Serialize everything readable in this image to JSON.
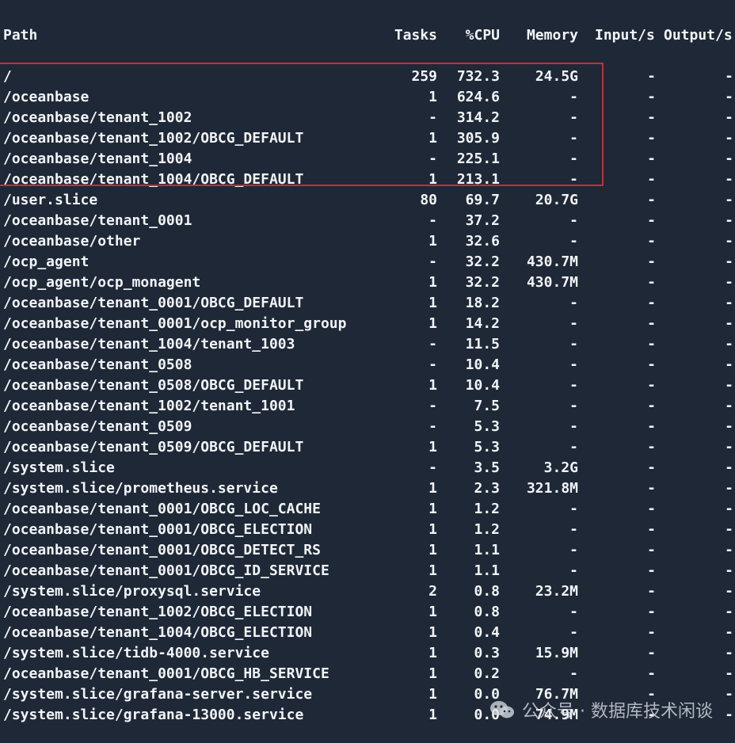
{
  "columns": {
    "path": "Path",
    "tasks": "Tasks",
    "cpu": "%CPU",
    "memory": "Memory",
    "input": "Input/s",
    "output": "Output/s"
  },
  "rows": [
    {
      "path": "/",
      "tasks": "259",
      "cpu": "732.3",
      "memory": "24.5G",
      "input": "-",
      "output": "-"
    },
    {
      "path": "/oceanbase",
      "tasks": "1",
      "cpu": "624.6",
      "memory": "-",
      "input": "-",
      "output": "-"
    },
    {
      "path": "/oceanbase/tenant_1002",
      "tasks": "-",
      "cpu": "314.2",
      "memory": "-",
      "input": "-",
      "output": "-"
    },
    {
      "path": "/oceanbase/tenant_1002/OBCG_DEFAULT",
      "tasks": "1",
      "cpu": "305.9",
      "memory": "-",
      "input": "-",
      "output": "-"
    },
    {
      "path": "/oceanbase/tenant_1004",
      "tasks": "-",
      "cpu": "225.1",
      "memory": "-",
      "input": "-",
      "output": "-"
    },
    {
      "path": "/oceanbase/tenant_1004/OBCG_DEFAULT",
      "tasks": "1",
      "cpu": "213.1",
      "memory": "-",
      "input": "-",
      "output": "-"
    },
    {
      "path": "/user.slice",
      "tasks": "80",
      "cpu": "69.7",
      "memory": "20.7G",
      "input": "-",
      "output": "-"
    },
    {
      "path": "/oceanbase/tenant_0001",
      "tasks": "-",
      "cpu": "37.2",
      "memory": "-",
      "input": "-",
      "output": "-"
    },
    {
      "path": "/oceanbase/other",
      "tasks": "1",
      "cpu": "32.6",
      "memory": "-",
      "input": "-",
      "output": "-"
    },
    {
      "path": "/ocp_agent",
      "tasks": "-",
      "cpu": "32.2",
      "memory": "430.7M",
      "input": "-",
      "output": "-"
    },
    {
      "path": "/ocp_agent/ocp_monagent",
      "tasks": "1",
      "cpu": "32.2",
      "memory": "430.7M",
      "input": "-",
      "output": "-"
    },
    {
      "path": "/oceanbase/tenant_0001/OBCG_DEFAULT",
      "tasks": "1",
      "cpu": "18.2",
      "memory": "-",
      "input": "-",
      "output": "-"
    },
    {
      "path": "/oceanbase/tenant_0001/ocp_monitor_group",
      "tasks": "1",
      "cpu": "14.2",
      "memory": "-",
      "input": "-",
      "output": "-"
    },
    {
      "path": "/oceanbase/tenant_1004/tenant_1003",
      "tasks": "-",
      "cpu": "11.5",
      "memory": "-",
      "input": "-",
      "output": "-"
    },
    {
      "path": "/oceanbase/tenant_0508",
      "tasks": "-",
      "cpu": "10.4",
      "memory": "-",
      "input": "-",
      "output": "-"
    },
    {
      "path": "/oceanbase/tenant_0508/OBCG_DEFAULT",
      "tasks": "1",
      "cpu": "10.4",
      "memory": "-",
      "input": "-",
      "output": "-"
    },
    {
      "path": "/oceanbase/tenant_1002/tenant_1001",
      "tasks": "-",
      "cpu": "7.5",
      "memory": "-",
      "input": "-",
      "output": "-"
    },
    {
      "path": "/oceanbase/tenant_0509",
      "tasks": "-",
      "cpu": "5.3",
      "memory": "-",
      "input": "-",
      "output": "-"
    },
    {
      "path": "/oceanbase/tenant_0509/OBCG_DEFAULT",
      "tasks": "1",
      "cpu": "5.3",
      "memory": "-",
      "input": "-",
      "output": "-"
    },
    {
      "path": "/system.slice",
      "tasks": "-",
      "cpu": "3.5",
      "memory": "3.2G",
      "input": "-",
      "output": "-"
    },
    {
      "path": "/system.slice/prometheus.service",
      "tasks": "1",
      "cpu": "2.3",
      "memory": "321.8M",
      "input": "-",
      "output": "-"
    },
    {
      "path": "/oceanbase/tenant_0001/OBCG_LOC_CACHE",
      "tasks": "1",
      "cpu": "1.2",
      "memory": "-",
      "input": "-",
      "output": "-"
    },
    {
      "path": "/oceanbase/tenant_0001/OBCG_ELECTION",
      "tasks": "1",
      "cpu": "1.2",
      "memory": "-",
      "input": "-",
      "output": "-"
    },
    {
      "path": "/oceanbase/tenant_0001/OBCG_DETECT_RS",
      "tasks": "1",
      "cpu": "1.1",
      "memory": "-",
      "input": "-",
      "output": "-"
    },
    {
      "path": "/oceanbase/tenant_0001/OBCG_ID_SERVICE",
      "tasks": "1",
      "cpu": "1.1",
      "memory": "-",
      "input": "-",
      "output": "-"
    },
    {
      "path": "/system.slice/proxysql.service",
      "tasks": "2",
      "cpu": "0.8",
      "memory": "23.2M",
      "input": "-",
      "output": "-"
    },
    {
      "path": "/oceanbase/tenant_1002/OBCG_ELECTION",
      "tasks": "1",
      "cpu": "0.8",
      "memory": "-",
      "input": "-",
      "output": "-"
    },
    {
      "path": "/oceanbase/tenant_1004/OBCG_ELECTION",
      "tasks": "1",
      "cpu": "0.4",
      "memory": "-",
      "input": "-",
      "output": "-"
    },
    {
      "path": "/system.slice/tidb-4000.service",
      "tasks": "1",
      "cpu": "0.3",
      "memory": "15.9M",
      "input": "-",
      "output": "-"
    },
    {
      "path": "/oceanbase/tenant_0001/OBCG_HB_SERVICE",
      "tasks": "1",
      "cpu": "0.2",
      "memory": "-",
      "input": "-",
      "output": "-"
    },
    {
      "path": "/system.slice/grafana-server.service",
      "tasks": "1",
      "cpu": "0.0",
      "memory": "76.7M",
      "input": "-",
      "output": "-"
    },
    {
      "path": "/system.slice/grafana-13000.service",
      "tasks": "1",
      "cpu": "0.0",
      "memory": "74.9M",
      "input": "-",
      "output": "-"
    }
  ],
  "watermark": {
    "text": "公众号 · 数据库技术闲谈",
    "icon": "wechat-icon"
  },
  "colors": {
    "background": "#1e2837",
    "text": "#f2f4f7",
    "highlight_border": "#d9272c"
  }
}
